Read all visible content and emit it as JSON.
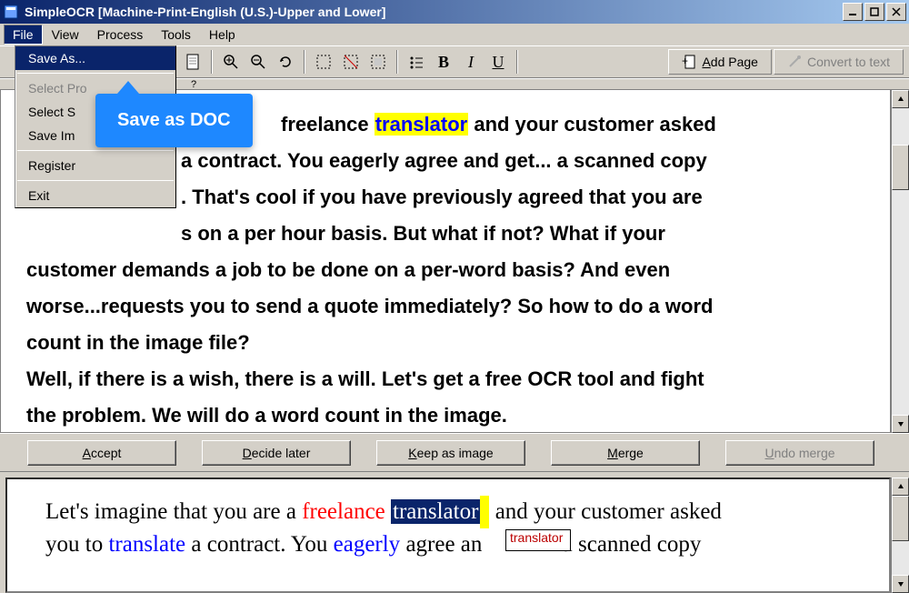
{
  "window": {
    "title": "SimpleOCR [Machine-Print-English (U.S.)-Upper and Lower]"
  },
  "menubar": [
    "File",
    "View",
    "Process",
    "Tools",
    "Help"
  ],
  "file_menu": {
    "save_as": "Save As...",
    "select_profile": "Select Pro",
    "select_source": "Select S",
    "save_image": "Save Im",
    "register": "Register",
    "exit": "Exit"
  },
  "callout": "Save as DOC",
  "toolbar": {
    "add_page": "Add Page",
    "convert": "Convert to text"
  },
  "doc_text": {
    "line1_pre": "freelance ",
    "line1_hl": "translator",
    "line1_post": " and your customer asked",
    "line2": "a contract. You eagerly agree and get... a scanned copy",
    "line3": ". That's cool if you have previously agreed that you are",
    "line4": "s on a per hour basis. But what if not? What if your",
    "line5": "customer demands a job to be done on a per-word basis? And even",
    "line6": "worse...requests you to send a quote immediately? So how to do a word",
    "line7": "count in the image file?",
    "line8": "Well, if there is a wish, there is a will. Let's get a free OCR tool and fight",
    "line9": "the problem. We will do a word count in the image."
  },
  "actions": {
    "accept": "Accept",
    "decide": "Decide later",
    "keep": "Keep as image",
    "merge": "Merge",
    "undo": "Undo merge"
  },
  "edit_text": {
    "l1a": "Let's imagine that you are a ",
    "l1b": "freelance",
    "l1c": " ",
    "l1d": "translator",
    "l1e": " and your customer asked",
    "l2a": "you to ",
    "l2b": "translate",
    "l2c": " a contract. You ",
    "l2d": "eagerly",
    "l2e": " agree an",
    "l2f": " a scanned copy"
  },
  "suggestion": "translator"
}
